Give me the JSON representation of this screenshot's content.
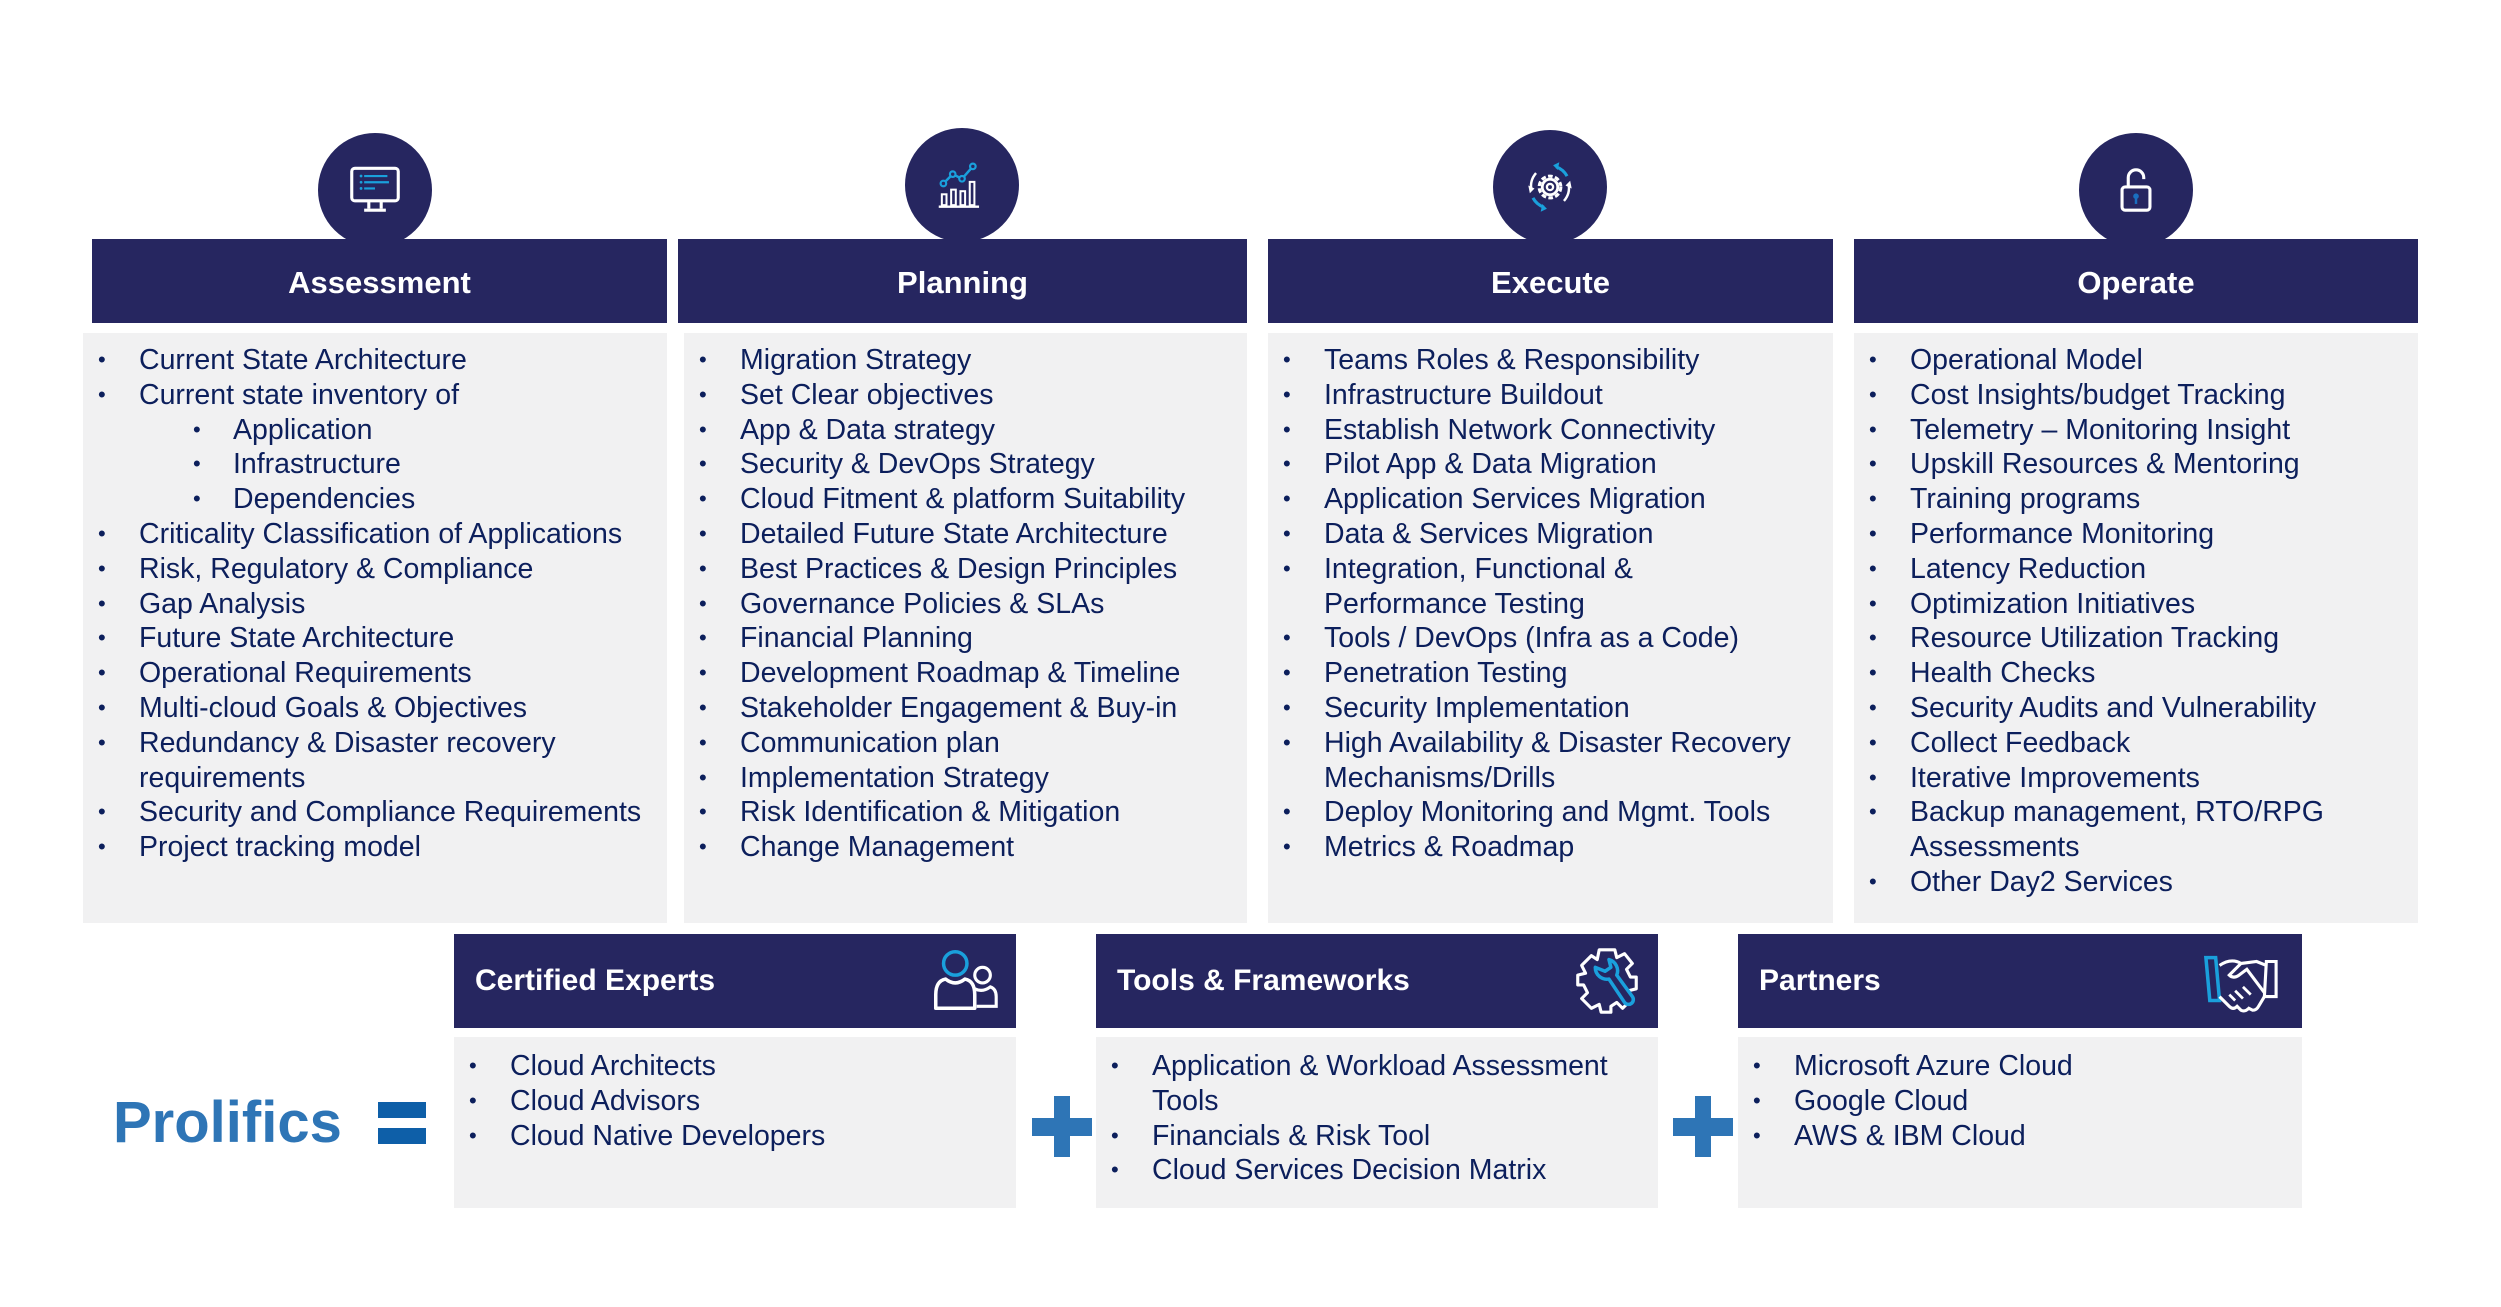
{
  "phases": [
    {
      "title": "Assessment",
      "icon": "monitor-icon",
      "items": [
        {
          "text": "Current State Architecture"
        },
        {
          "text": "Current state inventory of"
        },
        {
          "text": "Application",
          "sub": true
        },
        {
          "text": "Infrastructure",
          "sub": true
        },
        {
          "text": "Dependencies",
          "sub": true
        },
        {
          "text": "Criticality  Classification of Applications"
        },
        {
          "text": "Risk, Regulatory & Compliance"
        },
        {
          "text": "Gap Analysis"
        },
        {
          "text": "Future State Architecture"
        },
        {
          "text": "Operational Requirements"
        },
        {
          "text": "Multi-cloud Goals & Objectives"
        },
        {
          "text": "Redundancy & Disaster recovery requirements",
          "wrap": true
        },
        {
          "text": "Security and Compliance Requirements"
        },
        {
          "text": "Project tracking model"
        }
      ]
    },
    {
      "title": "Planning",
      "icon": "bar-chart-trend-icon",
      "items": [
        {
          "text": "Migration Strategy"
        },
        {
          "text": "Set Clear objectives"
        },
        {
          "text": "App & Data  strategy"
        },
        {
          "text": "Security & DevOps Strategy"
        },
        {
          "text": "Cloud Fitment & platform Suitability"
        },
        {
          "text": "Detailed Future State Architecture"
        },
        {
          "text": "Best Practices & Design Principles"
        },
        {
          "text": "Governance Policies & SLAs"
        },
        {
          "text": "Financial Planning"
        },
        {
          "text": "Development Roadmap & Timeline"
        },
        {
          "text": "Stakeholder Engagement & Buy-in"
        },
        {
          "text": "Communication plan"
        },
        {
          "text": "Implementation Strategy"
        },
        {
          "text": "Risk Identification & Mitigation"
        },
        {
          "text": "Change Management"
        }
      ]
    },
    {
      "title": "Execute",
      "icon": "gear-cycle-icon",
      "items": [
        {
          "text": "Teams Roles & Responsibility"
        },
        {
          "text": "Infrastructure Buildout"
        },
        {
          "text": "Establish Network Connectivity"
        },
        {
          "text": "Pilot App & Data Migration"
        },
        {
          "text": "Application Services Migration"
        },
        {
          "text": "Data & Services Migration"
        },
        {
          "text": "Integration, Functional & Performance Testing",
          "wrap": true
        },
        {
          "text": "Tools / DevOps (Infra as a Code)"
        },
        {
          "text": "Penetration Testing"
        },
        {
          "text": "Security Implementation"
        },
        {
          "text": "High Availability & Disaster Recovery Mechanisms/Drills",
          "wrap": true
        },
        {
          "text": "Deploy Monitoring and Mgmt. Tools"
        },
        {
          "text": "Metrics & Roadmap"
        }
      ]
    },
    {
      "title": "Operate",
      "icon": "unlocked-padlock-icon",
      "items": [
        {
          "text": "Operational Model"
        },
        {
          "text": "Cost Insights/budget Tracking"
        },
        {
          "text": "Telemetry – Monitoring Insight"
        },
        {
          "text": "Upskill Resources & Mentoring"
        },
        {
          "text": "Training programs"
        },
        {
          "text": "Performance Monitoring"
        },
        {
          "text": "Latency Reduction"
        },
        {
          "text": "Optimization Initiatives"
        },
        {
          "text": "Resource Utilization Tracking"
        },
        {
          "text": "Health Checks"
        },
        {
          "text": "Security Audits and Vulnerability"
        },
        {
          "text": "Collect Feedback"
        },
        {
          "text": "Iterative Improvements"
        },
        {
          "text": "Backup management, RTO/RPG Assessments",
          "wrap": true
        },
        {
          "text": "Other Day2 Services"
        }
      ]
    }
  ],
  "brand": {
    "name": "Prolifics",
    "equals_symbol": "equals-icon"
  },
  "pillars": [
    {
      "title": "Certified Experts",
      "icon": "people-icon",
      "items": [
        "Cloud Architects",
        "Cloud Advisors",
        "Cloud Native Developers"
      ]
    },
    {
      "title": "Tools & Frameworks",
      "icon": "gear-wrench-icon",
      "items": [
        "Application & Workload Assessment Tools",
        " Financials & Risk Tool",
        "Cloud Services Decision Matrix"
      ]
    },
    {
      "title": "Partners",
      "icon": "handshake-icon",
      "items": [
        "Microsoft Azure Cloud",
        "Google Cloud",
        "AWS & IBM Cloud"
      ]
    }
  ],
  "colors": {
    "navy": "#262660",
    "panel": "#f1f1f2",
    "text": "#0c1f5c",
    "accent_blue": "#2e75b6",
    "icon_cyan": "#1aa0dc"
  }
}
